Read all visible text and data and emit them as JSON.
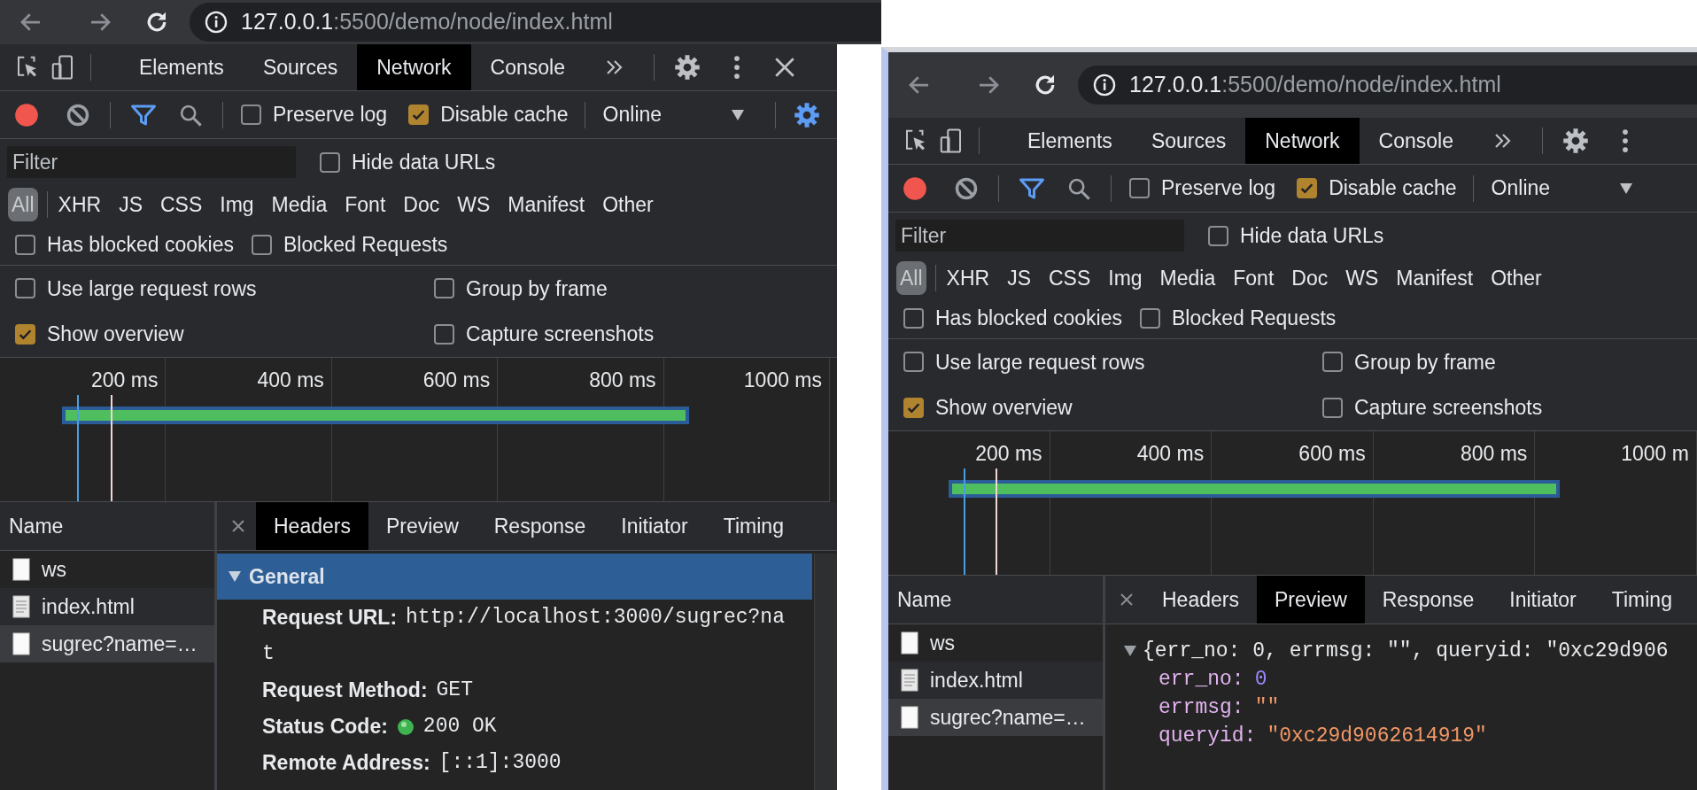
{
  "windows": [
    {
      "address": {
        "host": "127.0.0.1",
        "path": ":5500/demo/node/index.html"
      },
      "panel_tabs": [
        {
          "label": "Elements",
          "selected": false
        },
        {
          "label": "Sources",
          "selected": false
        },
        {
          "label": "Network",
          "selected": true
        },
        {
          "label": "Console",
          "selected": false
        }
      ],
      "close_button": true,
      "toolbar": {
        "recording": true,
        "preserve_log": {
          "label": "Preserve log",
          "checked": false
        },
        "disable_cache": {
          "label": "Disable cache",
          "checked": true
        },
        "throttling": "Online",
        "settings_button": true
      },
      "filter": {
        "placeholder": "Filter",
        "hide_data_urls": {
          "label": "Hide data URLs",
          "checked": false
        }
      },
      "type_filters": [
        {
          "label": "All",
          "selected": true
        },
        {
          "label": "XHR",
          "selected": false
        },
        {
          "label": "JS",
          "selected": false
        },
        {
          "label": "CSS",
          "selected": false
        },
        {
          "label": "Img",
          "selected": false
        },
        {
          "label": "Media",
          "selected": false
        },
        {
          "label": "Font",
          "selected": false
        },
        {
          "label": "Doc",
          "selected": false
        },
        {
          "label": "WS",
          "selected": false
        },
        {
          "label": "Manifest",
          "selected": false
        },
        {
          "label": "Other",
          "selected": false
        }
      ],
      "blocked_filters": [
        {
          "label": "Has blocked cookies",
          "checked": false
        },
        {
          "label": "Blocked Requests",
          "checked": false
        }
      ],
      "settings": [
        {
          "label": "Use large request rows",
          "checked": false
        },
        {
          "label": "Group by frame",
          "checked": false
        },
        {
          "label": "Show overview",
          "checked": true
        },
        {
          "label": "Capture screenshots",
          "checked": false
        }
      ],
      "overview": {
        "ticks": [
          "200 ms",
          "400 ms",
          "600 ms",
          "800 ms",
          "1000 ms"
        ]
      },
      "requests": {
        "header": "Name",
        "rows": [
          {
            "name": "ws",
            "kind": "resource",
            "selected": false
          },
          {
            "name": "index.html",
            "kind": "document",
            "selected": false
          },
          {
            "name": "sugrec?name=…",
            "kind": "resource",
            "selected": true
          }
        ]
      },
      "details": {
        "tabs": [
          {
            "label": "Headers",
            "selected": true
          },
          {
            "label": "Preview",
            "selected": false
          },
          {
            "label": "Response",
            "selected": false
          },
          {
            "label": "Initiator",
            "selected": false
          },
          {
            "label": "Timing",
            "selected": false
          }
        ],
        "panel": {
          "kind": "headers",
          "title": "General",
          "expanded": true,
          "rows": [
            {
              "label": "Request URL:",
              "value": [
                "http://localhost:3000/sugrec?na",
                "t"
              ],
              "status_ok": false
            },
            {
              "label": "Request Method:",
              "value": [
                "GET"
              ],
              "status_ok": false
            },
            {
              "label": "Status Code:",
              "value": [
                "200 OK"
              ],
              "status_ok": true
            },
            {
              "label": "Remote Address:",
              "value": [
                "[::1]:3000"
              ],
              "status_ok": false
            }
          ]
        }
      }
    },
    {
      "address": {
        "host": "127.0.0.1",
        "path": ":5500/demo/node/index.html"
      },
      "panel_tabs": [
        {
          "label": "Elements",
          "selected": false
        },
        {
          "label": "Sources",
          "selected": false
        },
        {
          "label": "Network",
          "selected": true
        },
        {
          "label": "Console",
          "selected": false
        }
      ],
      "close_button": false,
      "toolbar": {
        "recording": true,
        "preserve_log": {
          "label": "Preserve log",
          "checked": false
        },
        "disable_cache": {
          "label": "Disable cache",
          "checked": true
        },
        "throttling": "Online",
        "settings_button": false
      },
      "filter": {
        "placeholder": "Filter",
        "hide_data_urls": {
          "label": "Hide data URLs",
          "checked": false
        }
      },
      "type_filters": [
        {
          "label": "All",
          "selected": true
        },
        {
          "label": "XHR",
          "selected": false
        },
        {
          "label": "JS",
          "selected": false
        },
        {
          "label": "CSS",
          "selected": false
        },
        {
          "label": "Img",
          "selected": false
        },
        {
          "label": "Media",
          "selected": false
        },
        {
          "label": "Font",
          "selected": false
        },
        {
          "label": "Doc",
          "selected": false
        },
        {
          "label": "WS",
          "selected": false
        },
        {
          "label": "Manifest",
          "selected": false
        },
        {
          "label": "Other",
          "selected": false
        }
      ],
      "blocked_filters": [
        {
          "label": "Has blocked cookies",
          "checked": false
        },
        {
          "label": "Blocked Requests",
          "checked": false
        }
      ],
      "settings": [
        {
          "label": "Use large request rows",
          "checked": false
        },
        {
          "label": "Group by frame",
          "checked": false
        },
        {
          "label": "Show overview",
          "checked": true
        },
        {
          "label": "Capture screenshots",
          "checked": false
        }
      ],
      "overview": {
        "ticks": [
          "200 ms",
          "400 ms",
          "600 ms",
          "800 ms",
          "1000 m"
        ]
      },
      "requests": {
        "header": "Name",
        "rows": [
          {
            "name": "ws",
            "kind": "resource",
            "selected": false
          },
          {
            "name": "index.html",
            "kind": "document",
            "selected": false
          },
          {
            "name": "sugrec?name=…",
            "kind": "resource",
            "selected": true
          }
        ]
      },
      "details": {
        "tabs": [
          {
            "label": "Headers",
            "selected": false
          },
          {
            "label": "Preview",
            "selected": true
          },
          {
            "label": "Response",
            "selected": false
          },
          {
            "label": "Initiator",
            "selected": false
          },
          {
            "label": "Timing",
            "selected": false
          }
        ],
        "panel": {
          "kind": "preview",
          "summary": "{err_no: 0, errmsg: \"\", queryid: \"0xc29d906",
          "expanded": true,
          "children": [
            {
              "key": "err_no:",
              "value": "0",
              "kind": "number"
            },
            {
              "key": "errmsg:",
              "value": "\"\"",
              "kind": "string"
            },
            {
              "key": "queryid:",
              "value": "\"0xc29d9062614919\"",
              "kind": "string"
            }
          ]
        }
      }
    }
  ]
}
